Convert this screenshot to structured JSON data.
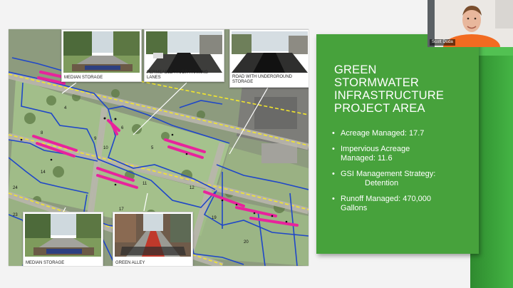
{
  "map": {
    "photo_captions": {
      "top_left": "MEDIAN STORAGE",
      "top_middle": "PERMEABLE PAVER PARKING LANES",
      "top_right": "ROAD WITH UNDERGROUND STORAGE",
      "bottom_left": "MEDIAN STORAGE",
      "bottom_middle": "GREEN ALLEY"
    },
    "area_labels": [
      "4",
      "5",
      "6",
      "8",
      "9",
      "10",
      "11",
      "12",
      "14",
      "17",
      "19",
      "20",
      "24",
      "23"
    ]
  },
  "panel": {
    "title": "GREEN\nSTORMWATER\nINFRASTRUCTURE\nPROJECT AREA",
    "bullets": [
      {
        "line1": "Acreage Managed: 17.7",
        "line2": ""
      },
      {
        "line1": "Impervious Acreage",
        "line2": "Managed: 11.6"
      },
      {
        "line1": "GSI Management Strategy:",
        "line2": "Detention"
      },
      {
        "line1": "Runoff Managed: 470,000",
        "line2": "Gallons"
      }
    ]
  },
  "webcam": {
    "participant_name": "Scott Duda"
  },
  "colors": {
    "panel_green": "#47a23c",
    "boundary_blue": "#1f47c8",
    "gsi_magenta": "#e8239c",
    "road_yellow": "#f2e62d"
  }
}
